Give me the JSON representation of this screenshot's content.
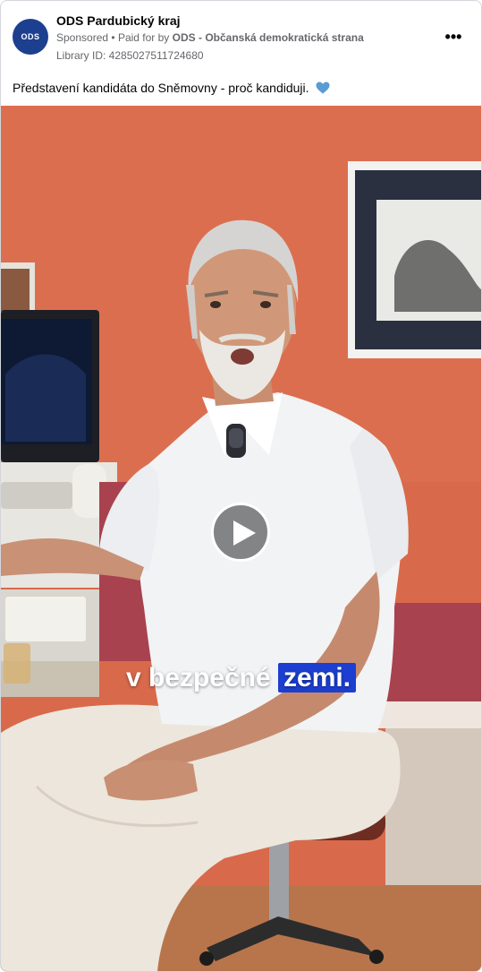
{
  "header": {
    "avatar_text": "ODS",
    "page_name": "ODS Pardubický kraj",
    "sponsored": "Sponsored",
    "separator": "•",
    "paid_for_by": "Paid for by",
    "payer": "ODS - Občanská demokratická strana",
    "library_id": "Library ID: 4285027511724680",
    "more_icon": "more-options-icon",
    "more_glyph": "•••"
  },
  "post": {
    "caption": "Představení kandidáta do Sněmovny - proč kandiduji.",
    "emoji": "blue-heart"
  },
  "video": {
    "subtitle_plain": "v bezpečné",
    "subtitle_highlight": "zemi.",
    "play_icon": "play-icon",
    "highlight_color": "#1c3fd1",
    "wall_color": "#d96a4a"
  }
}
